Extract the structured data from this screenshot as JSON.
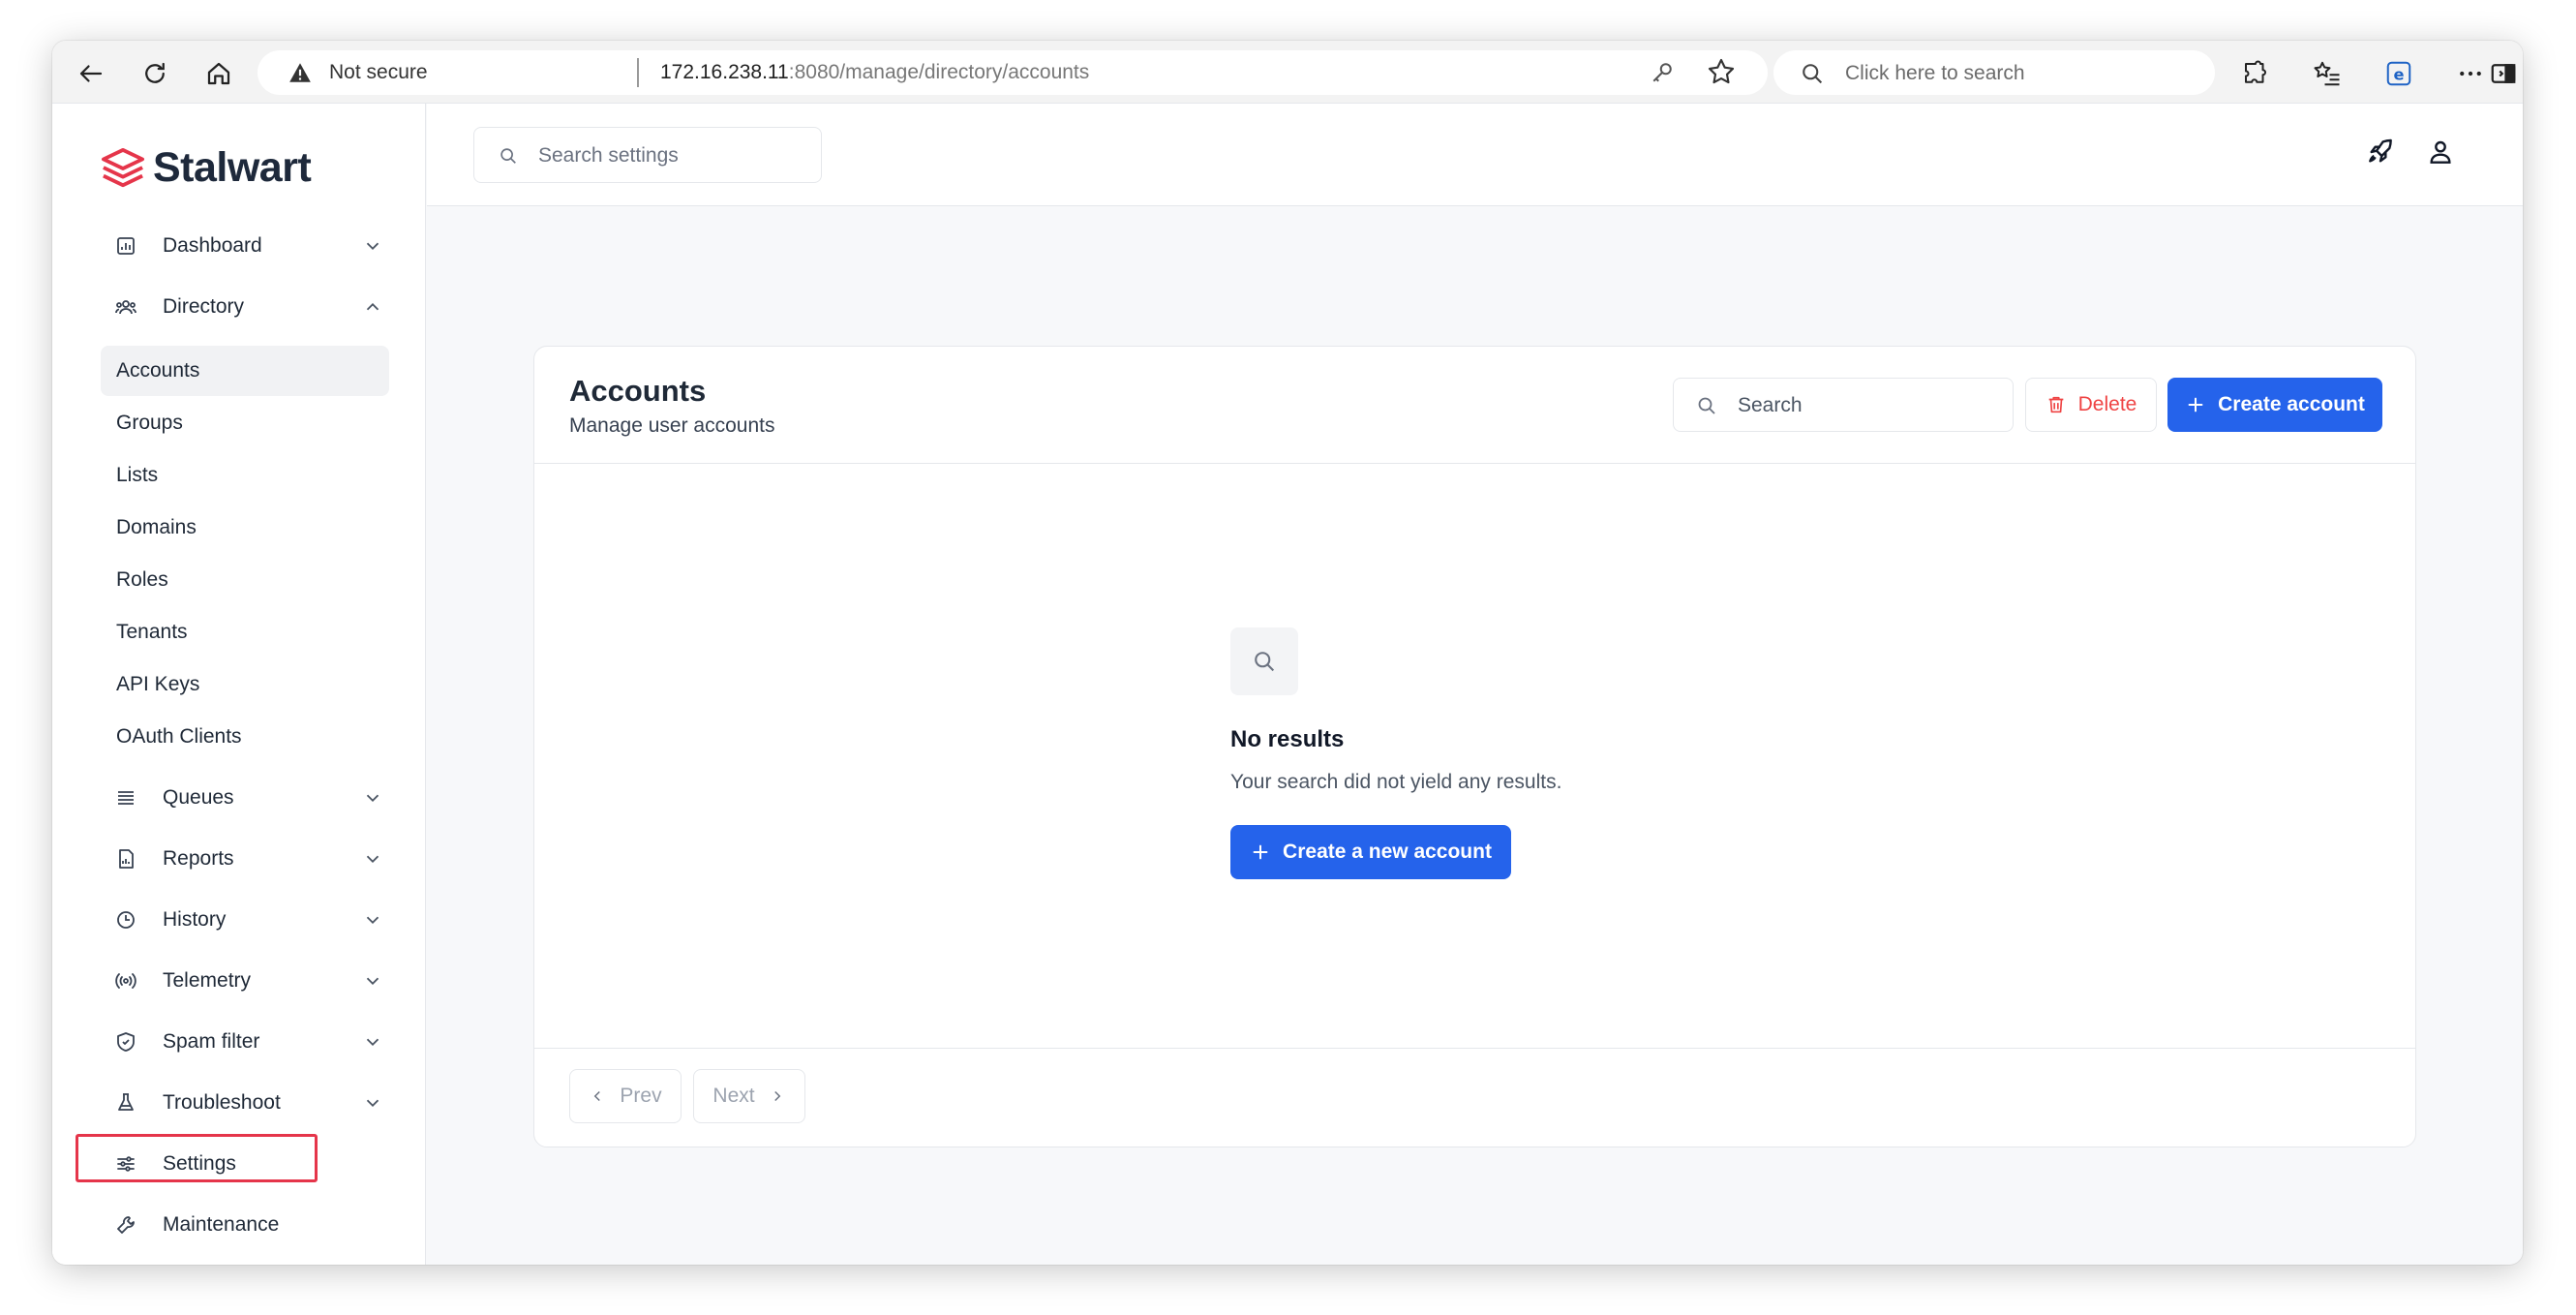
{
  "browser": {
    "not_secure": "Not secure",
    "url_host": "172.16.238.11",
    "url_rest": ":8080/manage/directory/accounts",
    "search_placeholder": "Click here to search"
  },
  "app": {
    "brand": "Stalwart",
    "settings_search_placeholder": "Search settings"
  },
  "sidebar": {
    "items": [
      {
        "label": "Dashboard",
        "icon": "dashboard-icon",
        "expanded": false
      },
      {
        "label": "Directory",
        "icon": "users-icon",
        "expanded": true
      },
      {
        "label": "Queues",
        "icon": "queue-icon",
        "expanded": false
      },
      {
        "label": "Reports",
        "icon": "report-icon",
        "expanded": false
      },
      {
        "label": "History",
        "icon": "clock-icon",
        "expanded": false
      },
      {
        "label": "Telemetry",
        "icon": "broadcast-icon",
        "expanded": false
      },
      {
        "label": "Spam filter",
        "icon": "shield-icon",
        "expanded": false
      },
      {
        "label": "Troubleshoot",
        "icon": "flask-icon",
        "expanded": false
      },
      {
        "label": "Settings",
        "icon": "sliders-icon"
      },
      {
        "label": "Maintenance",
        "icon": "wrench-icon"
      }
    ],
    "directory_sub": [
      "Accounts",
      "Groups",
      "Lists",
      "Domains",
      "Roles",
      "Tenants",
      "API Keys",
      "OAuth Clients"
    ]
  },
  "main": {
    "title": "Accounts",
    "subtitle": "Manage user accounts",
    "search_placeholder": "Search",
    "delete_label": "Delete",
    "create_label": "Create account",
    "empty_title": "No results",
    "empty_message": "Your search did not yield any results.",
    "create_new_label": "Create a new account",
    "prev_label": "Prev",
    "next_label": "Next"
  },
  "colors": {
    "primary": "#2563eb",
    "danger": "#ef4444",
    "highlight": "#e5354a"
  }
}
